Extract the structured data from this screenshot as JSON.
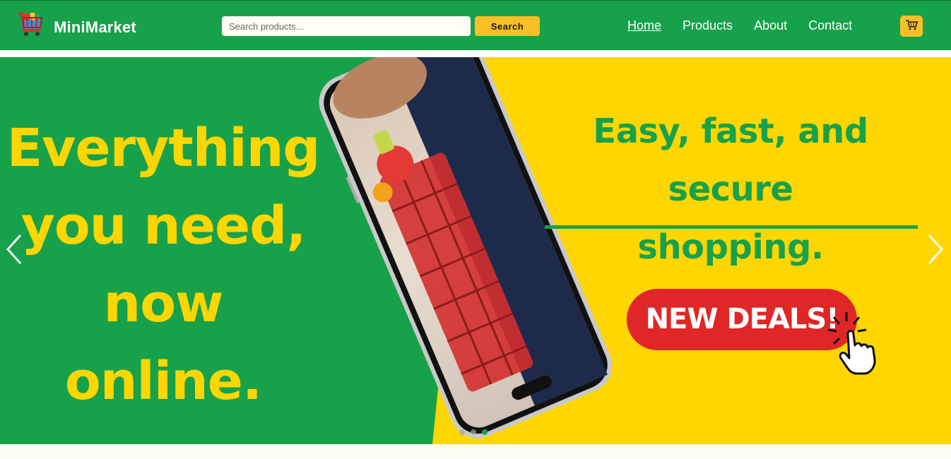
{
  "header": {
    "brand": "MiniMarket",
    "search": {
      "placeholder": "Search products...",
      "value": "",
      "button_label": "Search"
    },
    "nav": [
      {
        "label": "Home",
        "active": true
      },
      {
        "label": "Products",
        "active": false
      },
      {
        "label": "About",
        "active": false
      },
      {
        "label": "Contact",
        "active": false
      }
    ],
    "cart_icon": "cart-icon"
  },
  "hero": {
    "headline_lines": [
      "Everything",
      "you need,",
      "now online."
    ],
    "tagline_lines": [
      "Easy, fast, and secure",
      "shopping."
    ],
    "deals_label": "NEW DEALS!",
    "prev_icon": "chevron-left-icon",
    "next_icon": "chevron-right-icon",
    "slide_count": 3,
    "active_slide": 3
  },
  "colors": {
    "primary_green": "#17a14a",
    "accent_yellow": "#ffd600",
    "button_yellow": "#f9bf26",
    "deals_red": "#e02626"
  }
}
